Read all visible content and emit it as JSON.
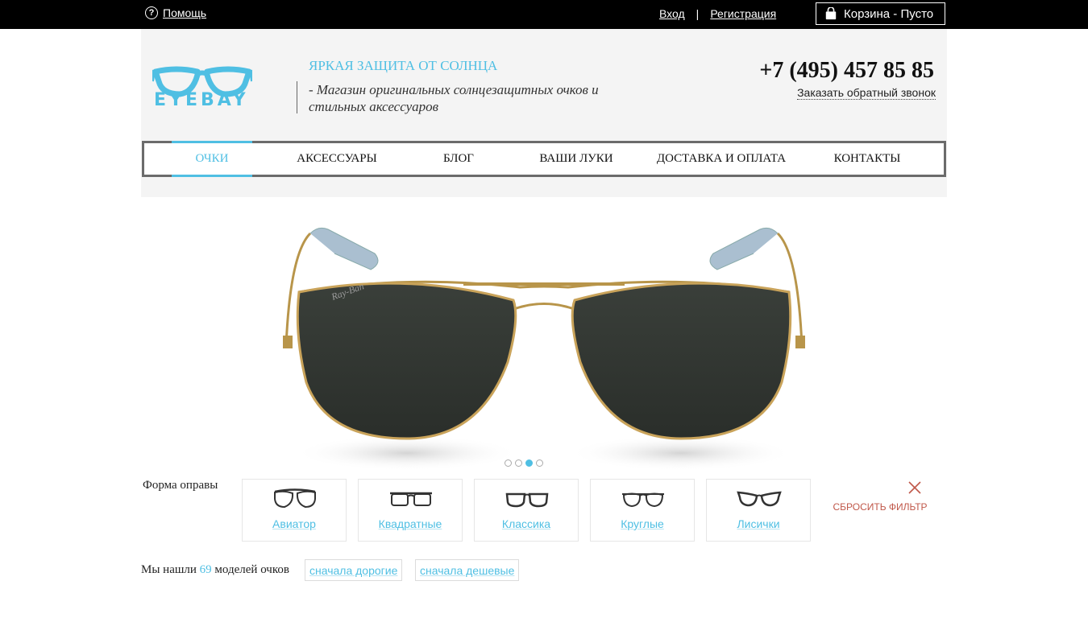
{
  "topbar": {
    "help_label": "Помощь",
    "login_label": "Вход",
    "separator": "|",
    "register_label": "Регистрация",
    "cart_label": "Корзина - Пусто"
  },
  "header": {
    "logo_text": "EYEBAY",
    "tagline_title": "ЯРКАЯ ЗАЩИТА ОТ СОЛНЦА",
    "tagline_sub": "- Магазин оригинальных солнцезащитных очков и стильных аксессуаров",
    "phone": "+7 (495) 457 85 85",
    "callback_label": "Заказать обратный звонок"
  },
  "nav": {
    "items": [
      {
        "label": "ОЧКИ",
        "active": true
      },
      {
        "label": "АКСЕССУАРЫ",
        "active": false
      },
      {
        "label": "БЛОГ",
        "active": false
      },
      {
        "label": "ВАШИ ЛУКИ",
        "active": false
      },
      {
        "label": "ДОСТАВКА И ОПЛАТА",
        "active": false
      },
      {
        "label": "КОНТАКТЫ",
        "active": false
      }
    ]
  },
  "slider": {
    "brand_mark": "Ray-Ban",
    "slide_count": 4,
    "active_index": 2
  },
  "filter": {
    "label": "Форма оправы",
    "shapes": [
      {
        "name": "Авиатор",
        "icon": "aviator-glasses-icon"
      },
      {
        "name": "Квадратные",
        "icon": "square-glasses-icon"
      },
      {
        "name": "Классика",
        "icon": "classic-glasses-icon"
      },
      {
        "name": "Круглые",
        "icon": "round-glasses-icon"
      },
      {
        "name": "Лисички",
        "icon": "cat-eye-glasses-icon"
      }
    ],
    "reset_label": "СБРОСИТЬ ФИЛЬТР"
  },
  "results": {
    "prefix": "Мы нашли",
    "count": "69",
    "suffix": "моделей очков",
    "sort_expensive": "сначала дорогие",
    "sort_cheap": "сначала дешевые"
  },
  "colors": {
    "accent": "#4fbfe3",
    "reset": "#c0584a",
    "topbar": "#000000",
    "header_bg": "#f4f4f4"
  }
}
